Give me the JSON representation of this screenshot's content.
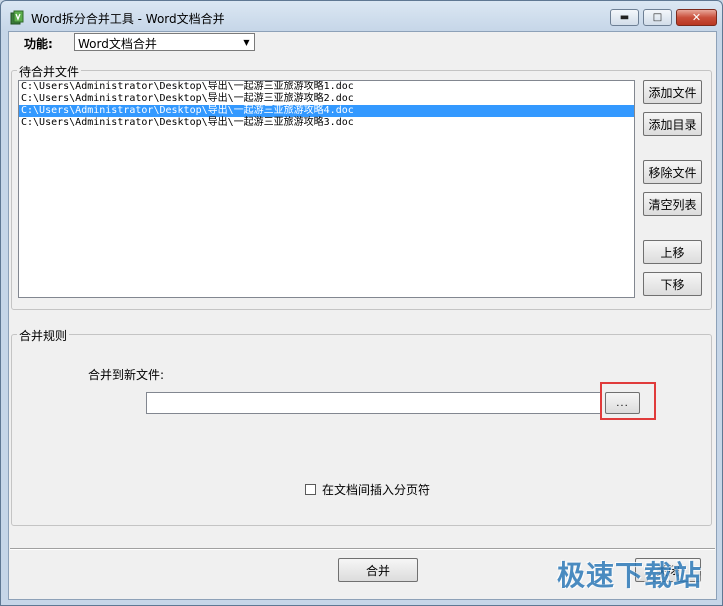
{
  "window": {
    "title": "Word拆分合并工具 - Word文档合并",
    "minimize_glyph": "▬",
    "maximize_glyph": "□",
    "close_glyph": "✕"
  },
  "function_selector": {
    "label": "功能:",
    "value": "Word文档合并",
    "dropdown_glyph": "▼"
  },
  "pending_files": {
    "legend": "待合并文件",
    "files": [
      {
        "path": "C:\\Users\\Administrator\\Desktop\\导出\\一起游三亚旅游攻略1.doc",
        "selected": false
      },
      {
        "path": "C:\\Users\\Administrator\\Desktop\\导出\\一起游三亚旅游攻略2.doc",
        "selected": false
      },
      {
        "path": "C:\\Users\\Administrator\\Desktop\\导出\\一起游三亚旅游攻略4.doc",
        "selected": true
      },
      {
        "path": "C:\\Users\\Administrator\\Desktop\\导出\\一起游三亚旅游攻略3.doc",
        "selected": false
      }
    ],
    "buttons": {
      "add_file": "添加文件",
      "add_folder": "添加目录",
      "remove_file": "移除文件",
      "clear_list": "清空列表",
      "move_up": "上移",
      "move_down": "下移"
    }
  },
  "merge_rules": {
    "legend": "合并规则",
    "merge_to_label": "合并到新文件:",
    "merge_to_value": "",
    "browse_label": "...",
    "page_break_label": "在文档间插入分页符",
    "page_break_checked": false
  },
  "actions": {
    "merge_label": "合并",
    "close_label": "关闭"
  },
  "watermark": "极速下载站",
  "colors": {
    "selection": "#3399ff",
    "highlight_box": "#e03b3b",
    "close_button": "#c94f3b"
  }
}
